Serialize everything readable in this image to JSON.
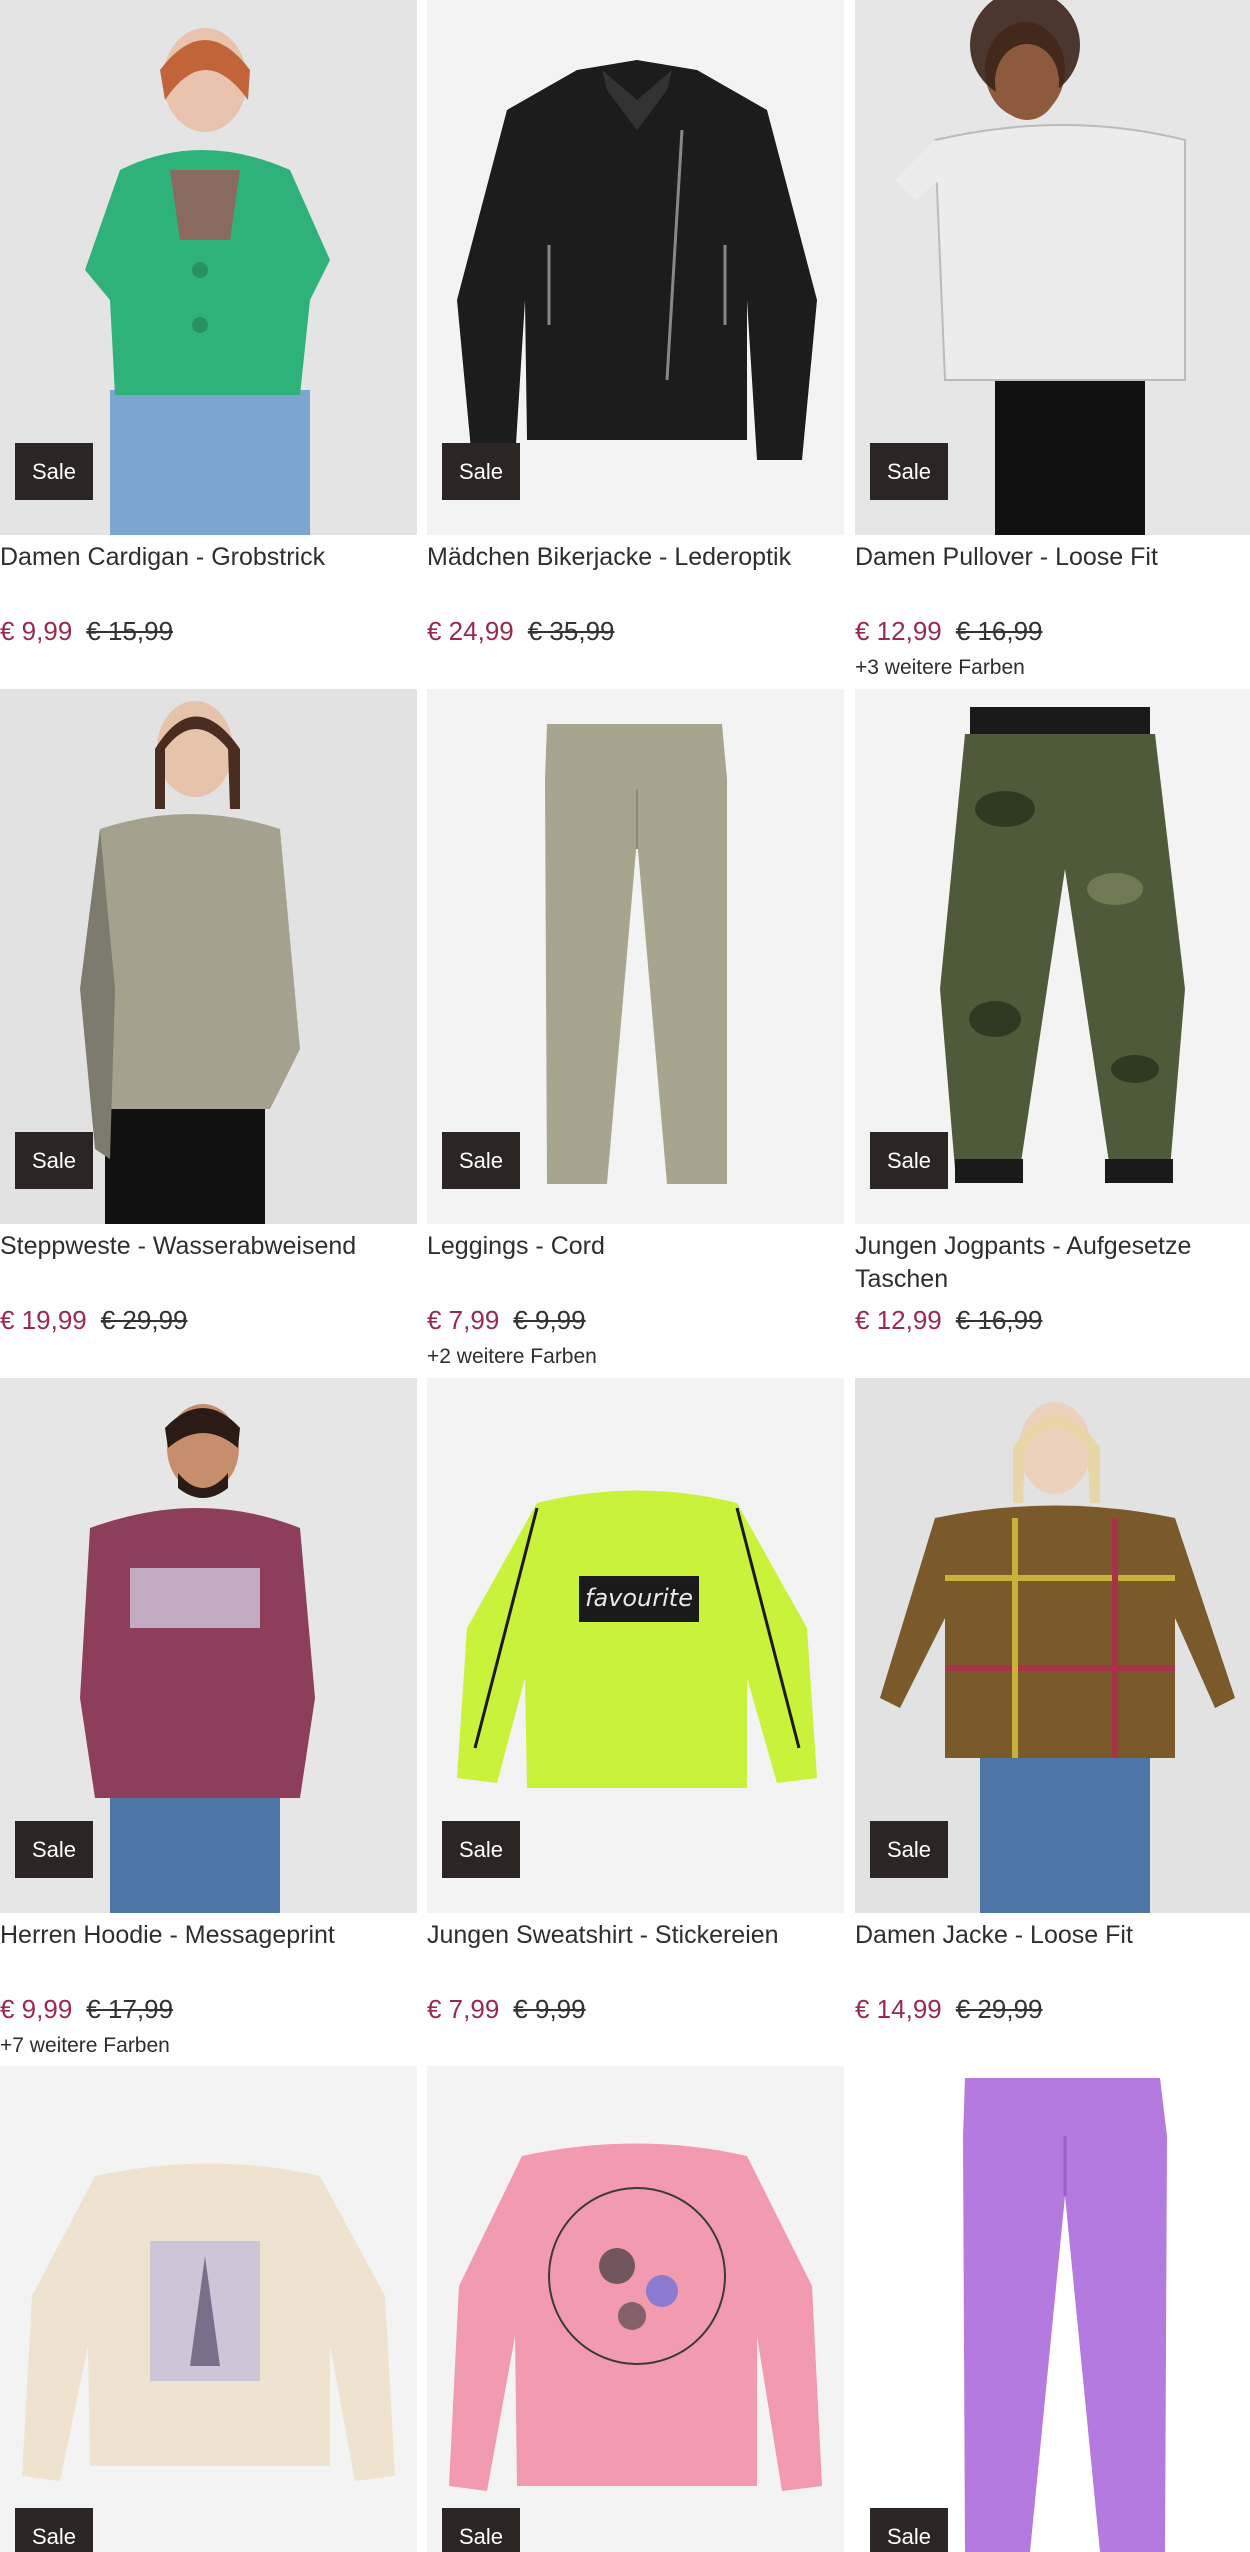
{
  "products": [
    {
      "title": "Damen Cardigan - Grobstrick",
      "price": "€ 9,99",
      "old_price": "€ 15,99",
      "badge": "Sale",
      "colors": "",
      "image": "woman-green-cardigan",
      "accent": "#2fb27a"
    },
    {
      "title": "Mädchen Bikerjacke - Lederoptik",
      "price": "€ 24,99",
      "old_price": "€ 35,99",
      "badge": "Sale",
      "colors": "",
      "image": "black-biker-jacket",
      "accent": "#1c1c1c"
    },
    {
      "title": "Damen Pullover - Loose Fit",
      "price": "€ 12,99",
      "old_price": "€ 16,99",
      "badge": "Sale",
      "colors": "+3 weitere Farben",
      "image": "woman-white-pullover",
      "accent": "#ededed"
    },
    {
      "title": "Steppweste - Wasserabweisend",
      "price": "€ 19,99",
      "old_price": "€ 29,99",
      "badge": "Sale",
      "colors": "",
      "image": "woman-grey-vest",
      "accent": "#a4a28f"
    },
    {
      "title": "Leggings - Cord",
      "price": "€ 7,99",
      "old_price": "€ 9,99",
      "badge": "Sale",
      "colors": "+2 weitere Farben",
      "image": "olive-leggings",
      "accent": "#a7a58e"
    },
    {
      "title": "Jungen Jogpants - Aufgesetze Taschen",
      "price": "€ 12,99",
      "old_price": "€ 16,99",
      "badge": "Sale",
      "colors": "",
      "image": "camo-jogpants",
      "accent": "#4f5a3a"
    },
    {
      "title": "Herren Hoodie - Messageprint",
      "price": "€ 9,99",
      "old_price": "€ 17,99",
      "badge": "Sale",
      "colors": "+7 weitere Farben",
      "image": "man-burgundy-hoodie",
      "accent": "#8c3e5a"
    },
    {
      "title": "Jungen Sweatshirt - Stickereien",
      "price": "€ 7,99",
      "old_price": "€ 9,99",
      "badge": "Sale",
      "colors": "",
      "image": "lime-sweatshirt",
      "accent": "#c9f23a"
    },
    {
      "title": "Damen Jacke - Loose Fit",
      "price": "€ 14,99",
      "old_price": "€ 29,99",
      "badge": "Sale",
      "colors": "",
      "image": "woman-plaid-jacket",
      "accent": "#7a5a2a"
    },
    {
      "title": "",
      "price": "",
      "old_price": "",
      "badge": "Sale",
      "colors": "",
      "image": "beige-sweatshirt",
      "accent": "#efe3cf"
    },
    {
      "title": "",
      "price": "",
      "old_price": "",
      "badge": "Sale",
      "colors": "",
      "image": "pink-sweatshirt",
      "accent": "#f29bb0"
    },
    {
      "title": "",
      "price": "",
      "old_price": "",
      "badge": "Sale",
      "colors": "",
      "image": "lilac-leggings",
      "accent": "#b57ae0"
    }
  ]
}
